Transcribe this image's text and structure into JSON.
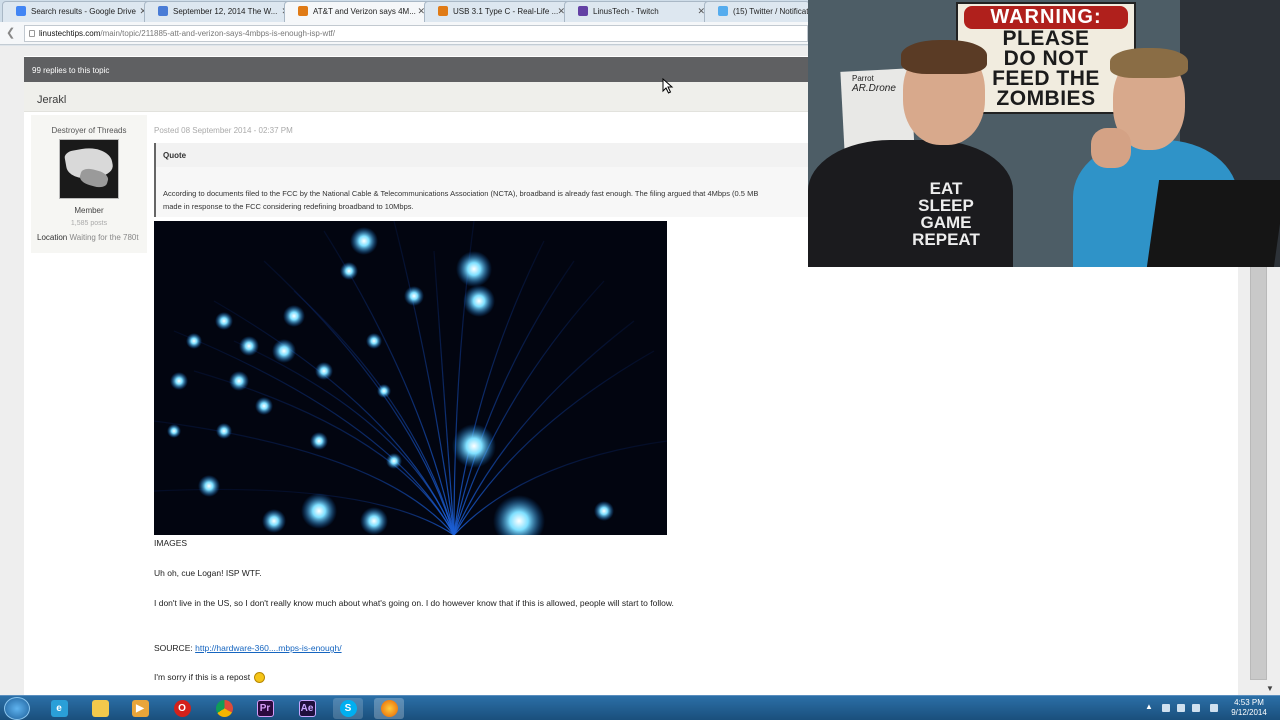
{
  "browser": {
    "tabs": [
      {
        "title": "Search results - Google Drive",
        "color": "#4285f4"
      },
      {
        "title": "September 12, 2014 The W...",
        "color": "#4a7cd6"
      },
      {
        "title": "AT&T and Verizon says 4M...",
        "color": "#e07b16"
      },
      {
        "title": "USB 3.1 Type C - Real-Life ...",
        "color": "#e07b16"
      },
      {
        "title": "LinusTech - Twitch",
        "color": "#6441a5"
      },
      {
        "title": "(15) Twitter / Notificat",
        "color": "#55acee"
      }
    ],
    "url_host": "linustechtips.com",
    "url_path": "/main/topic/211885-att-and-verizon-says-4mbps-is-enough-isp-wtf/"
  },
  "topic": {
    "replies_label": "99 replies to this topic",
    "author": "Jerakl"
  },
  "author_info": {
    "rank": "Destroyer of Threads",
    "group": "Member",
    "posts": "1,585 posts",
    "location_label": "Location",
    "location_value": "Waiting for the 780t"
  },
  "post": {
    "posted": "Posted 08 September 2014 - 02:37 PM",
    "quote_label": "Quote",
    "quote_line1": "According to documents filed to the FCC by the National Cable & Telecommunications Association (NCTA), broadband is already fast enough. The filing argued that 4Mbps (0.5 MB",
    "quote_line2": "made in response to the FCC considering redefining broadband to 10Mbps.",
    "images_label": "IMAGES",
    "line1": "Uh oh, cue Logan! ISP WTF.",
    "line2": "I don't live in the US, so I don't really know much about what's going on. I do however know that if this is allowed, people will start to follow.",
    "source_label": "SOURCE:",
    "source_link": "http://hardware-360....mbps-is-enough/",
    "line3": "I'm sorry if this is a repost"
  },
  "webcam": {
    "sign_top": "WARNING:",
    "sign_lines": [
      "PLEASE",
      "DO NOT",
      "FEED THE",
      "ZOMBIES"
    ],
    "box_brand": "Parrot",
    "box_name": "AR.Drone",
    "shirt_lines": [
      "EAT",
      "SLEEP",
      "GAME",
      "REPEAT"
    ]
  },
  "taskbar": {
    "apps": [
      {
        "name": "ie-icon",
        "label": "e",
        "color": "#2a9fd8"
      },
      {
        "name": "explorer-icon",
        "label": "",
        "color": "#f2c94c"
      },
      {
        "name": "media-player-icon",
        "label": "▶",
        "color": "#e8a53a"
      },
      {
        "name": "opera-icon",
        "label": "O",
        "color": "#d3211b"
      },
      {
        "name": "chrome-icon",
        "label": "",
        "color": "#dd4b39"
      },
      {
        "name": "premiere-icon",
        "label": "Pr",
        "color": "#2b0a3d"
      },
      {
        "name": "after-effects-icon",
        "label": "Ae",
        "color": "#1f0f3d"
      },
      {
        "name": "skype-icon",
        "label": "S",
        "color": "#00aff0"
      },
      {
        "name": "firefox-icon",
        "label": "",
        "color": "#e66000"
      }
    ],
    "time": "4:53 PM",
    "date": "9/12/2014"
  }
}
